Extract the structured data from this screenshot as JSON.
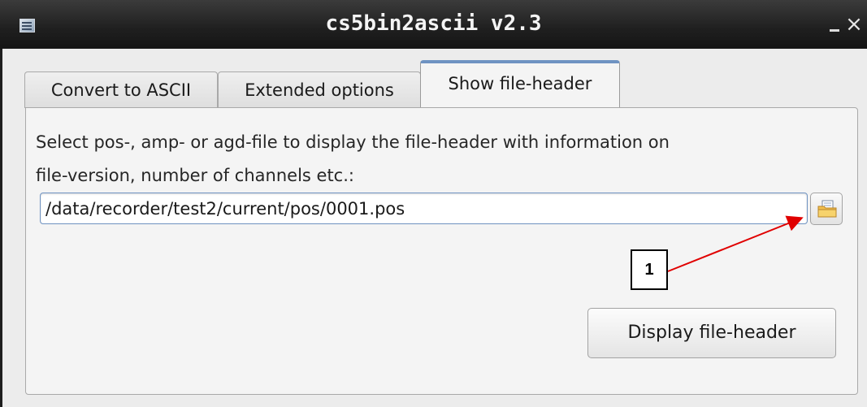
{
  "window": {
    "title": "cs5bin2ascii v2.3",
    "minimize_glyph": "_",
    "close_glyph": "×",
    "app_icon": "spreadsheet-icon"
  },
  "tabs": [
    {
      "label": "Convert to ASCII",
      "active": false
    },
    {
      "label": "Extended options",
      "active": false
    },
    {
      "label": "Show file-header",
      "active": true
    }
  ],
  "panel": {
    "description_line1": "Select pos-, amp- or agd-file to display the file-header with information on",
    "description_line2": "file-version, number of channels etc.:",
    "file_path_value": "/data/recorder/test2/current/pos/0001.pos",
    "browse_icon": "folder-icon",
    "display_button_label": "Display file-header"
  },
  "annotation": {
    "callout_label": "1",
    "arrow_color": "#e00000"
  },
  "colors": {
    "titlebar": "#1f1f1f",
    "accent": "#6f93c2",
    "background": "#ececec"
  }
}
